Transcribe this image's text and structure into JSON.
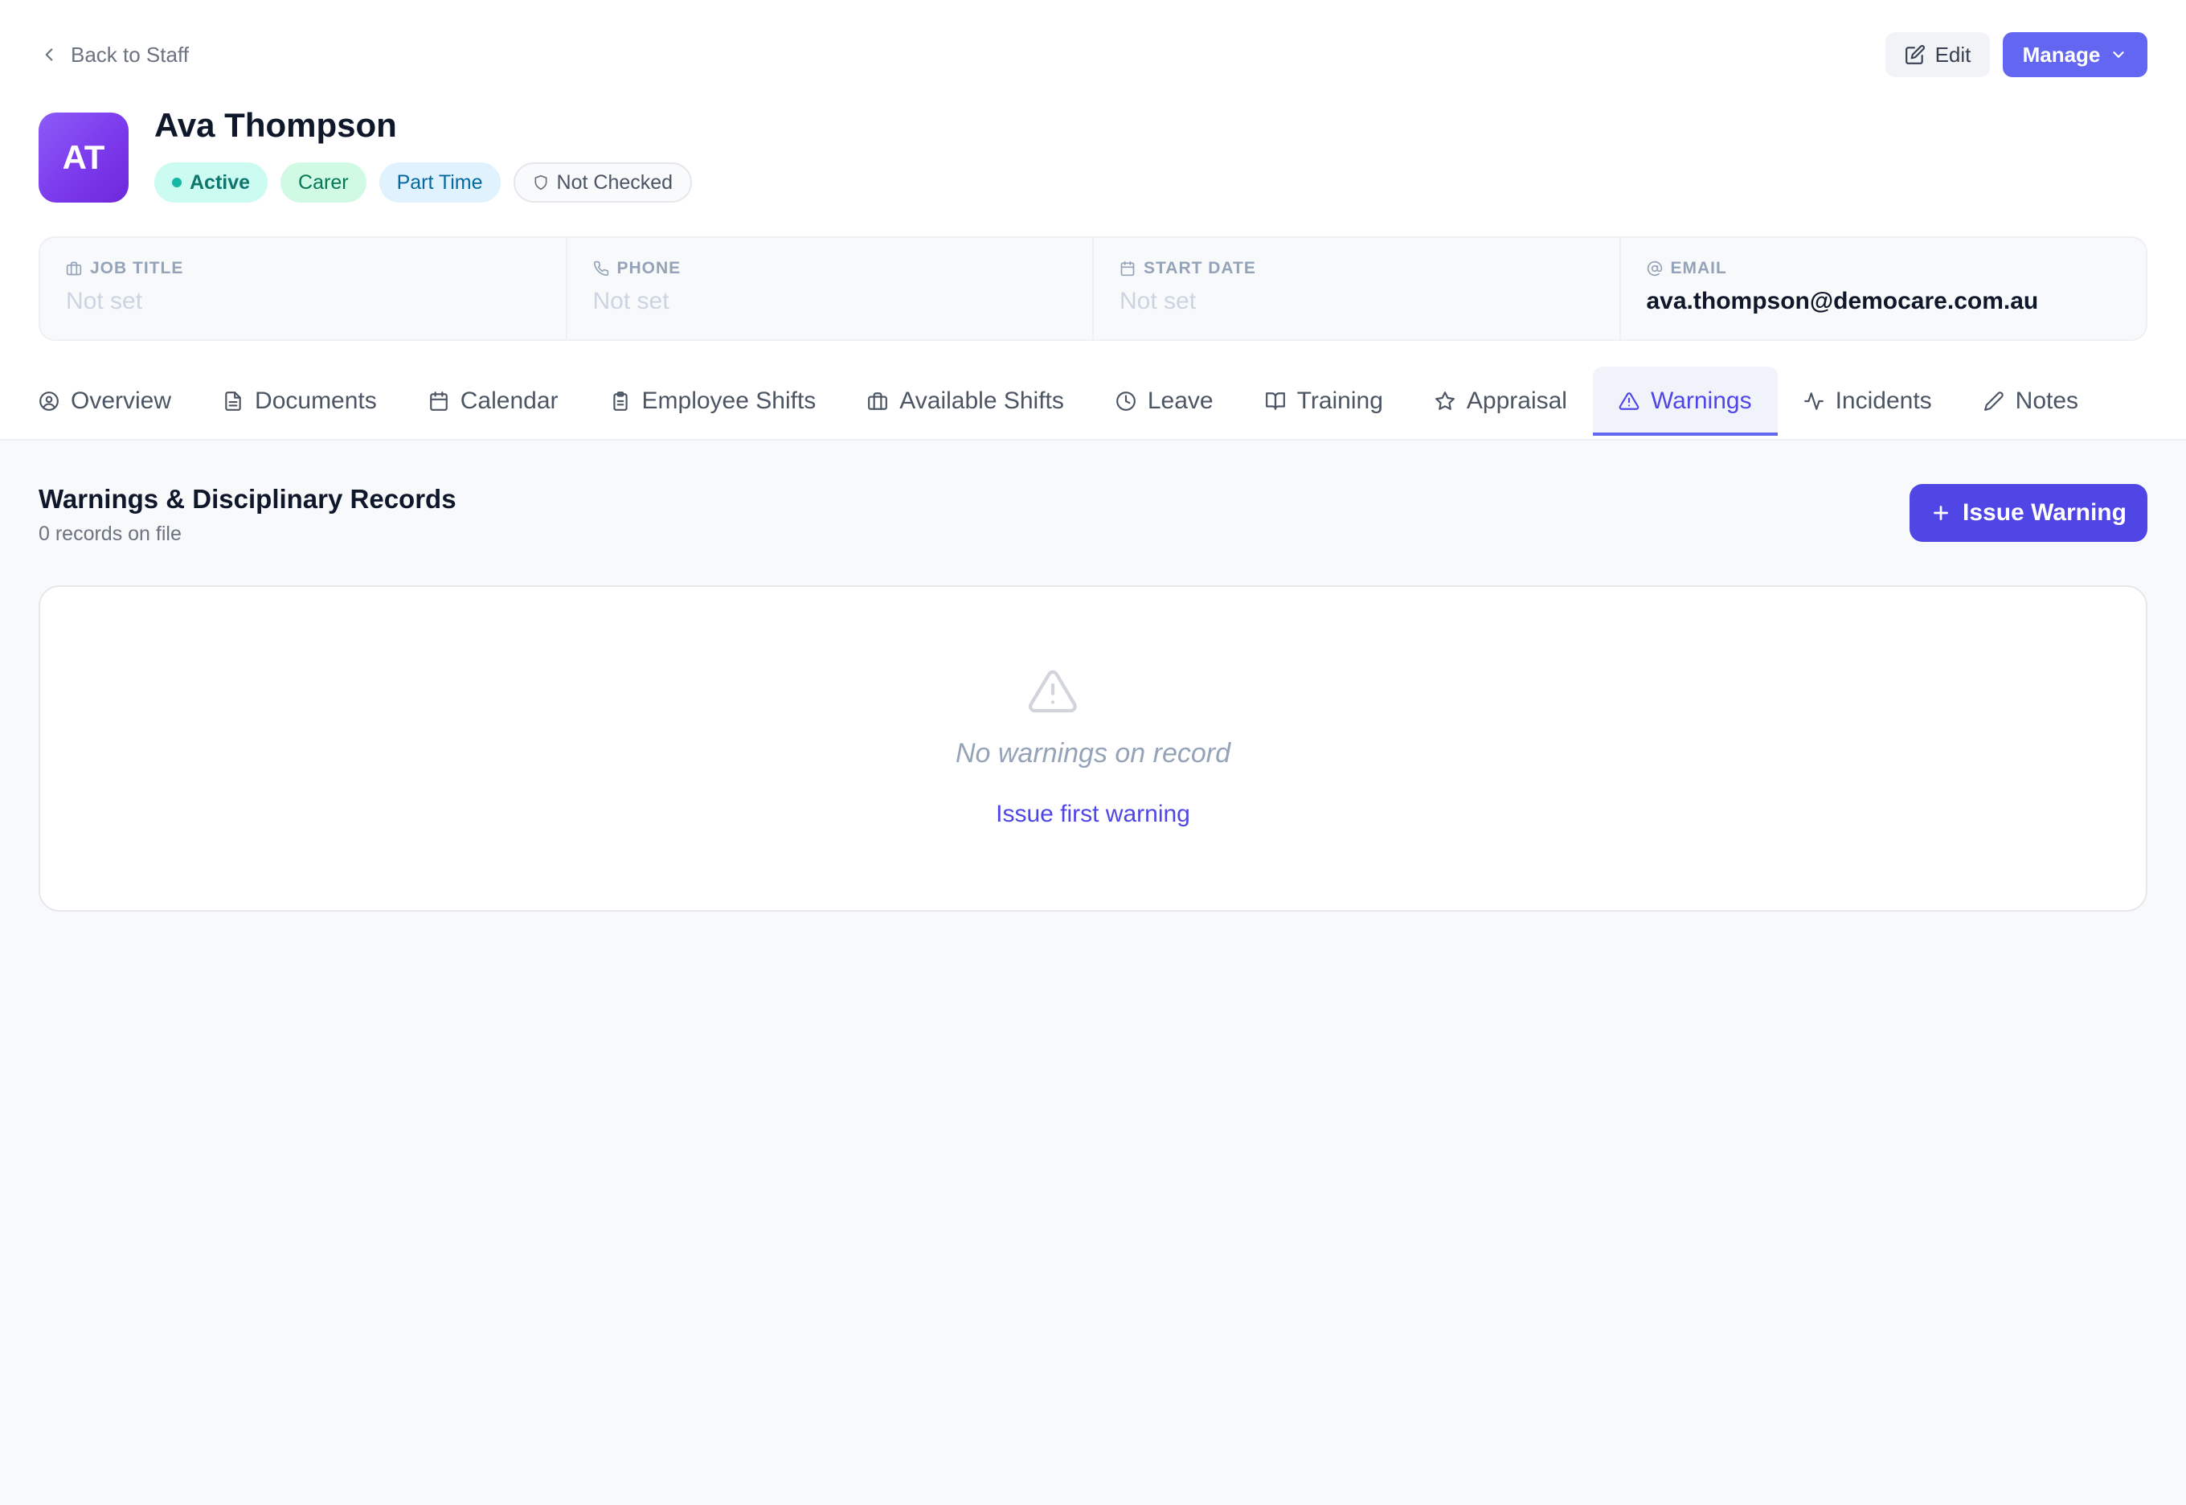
{
  "header": {
    "back_label": "Back to Staff",
    "edit_label": "Edit",
    "manage_label": "Manage"
  },
  "profile": {
    "initials": "AT",
    "name": "Ava Thompson",
    "badges": {
      "status": "Active",
      "role": "Carer",
      "employment": "Part Time",
      "check": "Not Checked"
    }
  },
  "info": [
    {
      "label": "JOB TITLE",
      "value": "Not set",
      "icon": "briefcase-icon"
    },
    {
      "label": "PHONE",
      "value": "Not set",
      "icon": "phone-icon"
    },
    {
      "label": "START DATE",
      "value": "Not set",
      "icon": "calendar-icon"
    },
    {
      "label": "EMAIL",
      "value": "ava.thompson@democare.com.au",
      "icon": "at-sign-icon"
    }
  ],
  "tabs": [
    {
      "label": "Overview",
      "icon": "user-circle-icon"
    },
    {
      "label": "Documents",
      "icon": "file-icon"
    },
    {
      "label": "Calendar",
      "icon": "calendar-icon"
    },
    {
      "label": "Employee Shifts",
      "icon": "clipboard-icon"
    },
    {
      "label": "Available Shifts",
      "icon": "briefcase-icon"
    },
    {
      "label": "Leave",
      "icon": "clock-icon"
    },
    {
      "label": "Training",
      "icon": "book-icon"
    },
    {
      "label": "Appraisal",
      "icon": "star-icon"
    },
    {
      "label": "Warnings",
      "icon": "warning-icon",
      "active": true
    },
    {
      "label": "Incidents",
      "icon": "activity-icon"
    },
    {
      "label": "Notes",
      "icon": "pencil-icon"
    }
  ],
  "section": {
    "title": "Warnings & Disciplinary Records",
    "subtitle": "0 records on file",
    "issue_button": "Issue Warning"
  },
  "empty_state": {
    "message": "No warnings on record",
    "link": "Issue first warning"
  },
  "colors": {
    "accent": "#4f46e5",
    "accent_light": "#6366f1",
    "background": "#f8f9fb"
  }
}
